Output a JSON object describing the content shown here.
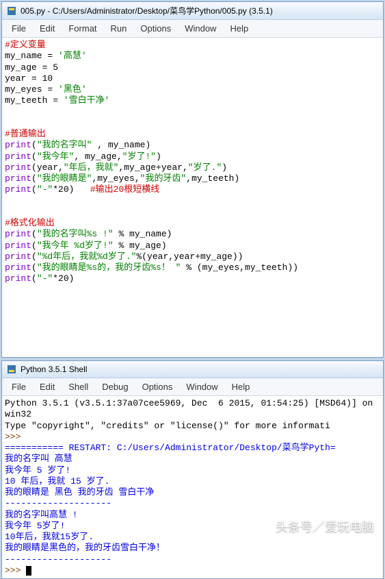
{
  "editor": {
    "title": "005.py - C:/Users/Administrator/Desktop/菜鸟学Python/005.py (3.5.1)",
    "menu": [
      "File",
      "Edit",
      "Format",
      "Run",
      "Options",
      "Window",
      "Help"
    ],
    "code": {
      "c1": "#定义变量",
      "l2a": "my_name = ",
      "l2b": "'高慧'",
      "l3a": "my_age = ",
      "l3b": "5",
      "l4a": "year = ",
      "l4b": "10",
      "l5a": "my_eyes = ",
      "l5b": "'黑色'",
      "l6a": "my_teeth = ",
      "l6b": "'雪白干净'",
      "c2": "#普通输出",
      "p1a": "print",
      "p1b": "(",
      "p1c": "\"我的名字叫\"",
      "p1d": " , my_name)",
      "p2a": "print",
      "p2b": "(",
      "p2c": "\"我今年\"",
      "p2d": ", my_age,",
      "p2e": "\"岁了!\"",
      "p2f": ")",
      "p3a": "print",
      "p3b": "(year,",
      "p3c": "\"年后，我就\"",
      "p3d": ",my_age+year,",
      "p3e": "\"岁了.\"",
      "p3f": ")",
      "p4a": "print",
      "p4b": "(",
      "p4c": "\"我的眼睛是\"",
      "p4d": ",my_eyes,",
      "p4e": "\"我的牙齿\"",
      "p4f": ",my_teeth)",
      "p5a": "print",
      "p5b": "(",
      "p5c": "\"-\"",
      "p5d": "*",
      "p5e": "20",
      "p5f": ")   ",
      "p5g": "#输出20根短横线",
      "c3": "#格式化输出",
      "p6a": "print",
      "p6b": "(",
      "p6c": "\"我的名字叫%s !\"",
      "p6d": " % my_name)",
      "p7a": "print",
      "p7b": "(",
      "p7c": "\"我今年 %d岁了!\"",
      "p7d": " % my_age)",
      "p8a": "print",
      "p8b": "(",
      "p8c": "\"%d年后，我就%d岁了.\"",
      "p8d": "%(year,year+my_age))",
      "p9a": "print",
      "p9b": "(",
      "p9c": "\"我的眼睛是%s的，我的牙齿%s！ \"",
      "p9d": " % (my_eyes,my_teeth))",
      "p10a": "print",
      "p10b": "(",
      "p10c": "\"-\"",
      "p10d": "*",
      "p10e": "20",
      "p10f": ")"
    }
  },
  "shell": {
    "title": "Python 3.5.1 Shell",
    "menu": [
      "File",
      "Edit",
      "Shell",
      "Debug",
      "Options",
      "Window",
      "Help"
    ],
    "banner1": "Python 3.5.1 (v3.5.1:37a07cee5969, Dec  6 2015, 01:54:25) [MSD64)] on win32",
    "banner2": "Type \"copyright\", \"credits\" or \"license()\" for more informati",
    "prompt": ">>>",
    "restart": "=========== RESTART: C:/Users/Administrator/Desktop/菜鸟学Pyth=",
    "out1": "我的名字叫 高慧",
    "out2": "我今年 5 岁了!",
    "out3": "10 年后，我就 15 岁了.",
    "out4": "我的眼睛是 黑色 我的牙齿 雪白干净",
    "dash1": "--------------------",
    "out5": "我的名字叫高慧 !",
    "out6": "我今年 5岁了!",
    "out7": "10年后，我就15岁了.",
    "out8": "我的眼睛是黑色的，我的牙齿雪白干净！",
    "dash2": "--------------------"
  },
  "watermark": "头条号／爱玩电脑"
}
